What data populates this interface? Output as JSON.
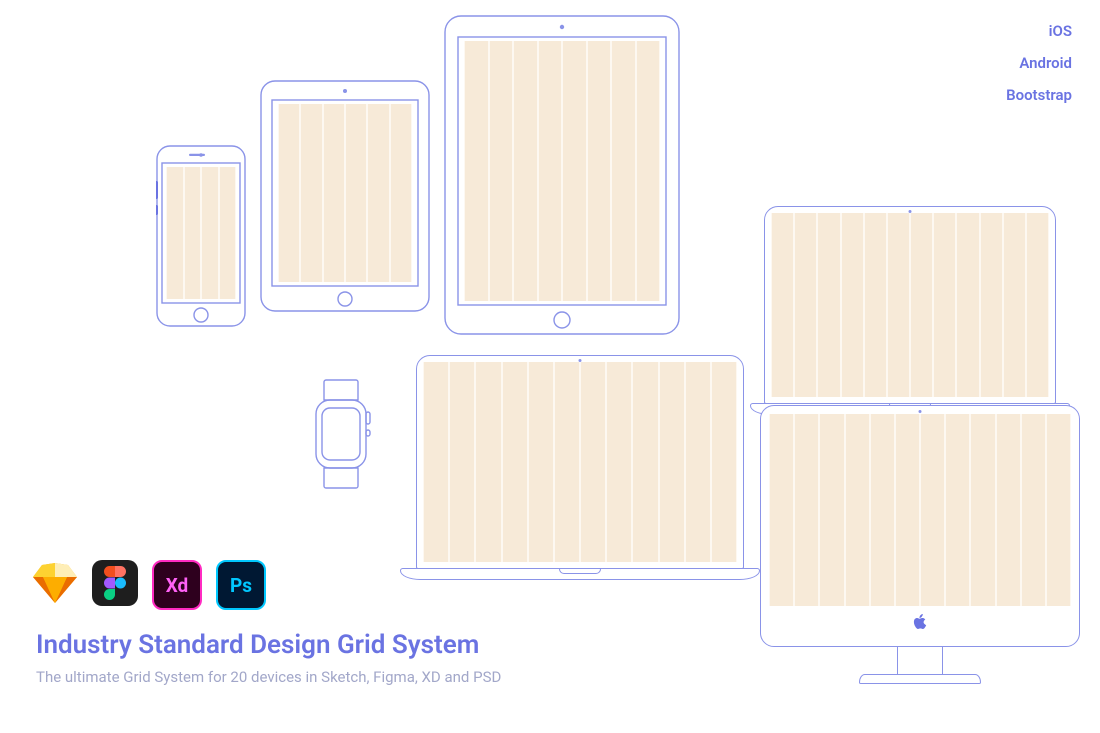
{
  "nav": {
    "ios": "iOS",
    "android": "Android",
    "bootstrap": "Bootstrap"
  },
  "apps": {
    "sketch": {
      "name": "Sketch"
    },
    "figma": {
      "name": "Figma"
    },
    "xd": {
      "name": "Adobe XD",
      "badge": "Xd"
    },
    "photoshop": {
      "name": "Photoshop",
      "badge": "Ps"
    }
  },
  "title": "Industry Standard Design Grid System",
  "subtitle": "The ultimate Grid System for 20 devices in Sketch, Figma, XD and PSD",
  "devices": {
    "phone": "iPhone",
    "tabletSmall": "iPad mini",
    "tabletLarge": "iPad Pro",
    "watch": "Apple Watch",
    "laptopFront": "MacBook front",
    "laptopBack": "MacBook back",
    "desktop": "iMac"
  },
  "colors": {
    "outline": "#8a93e8",
    "columnLight": "#fdf8f1",
    "columnDark": "#f7ead8",
    "accent": "#6a73e2"
  }
}
